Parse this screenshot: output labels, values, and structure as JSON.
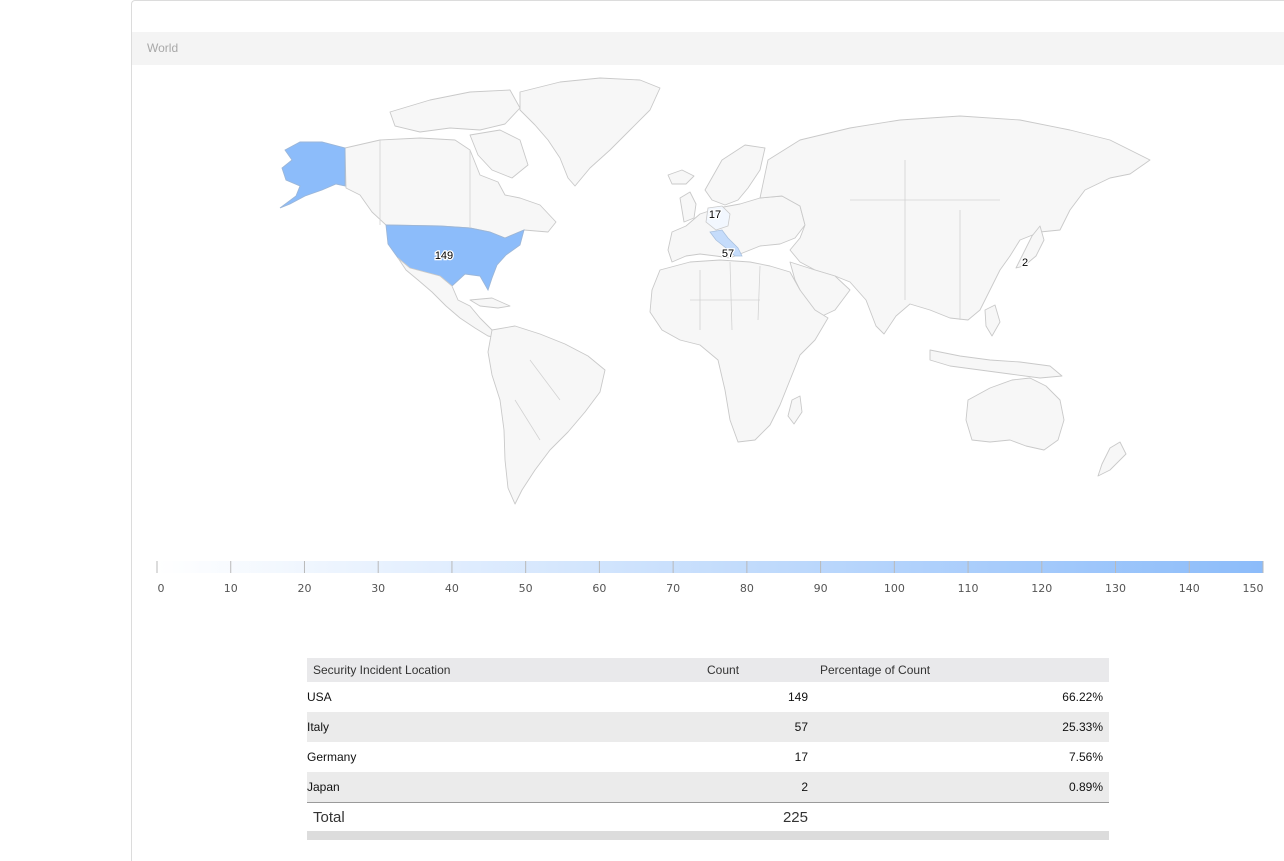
{
  "panel": {
    "title": "World"
  },
  "map": {
    "highlighted": [
      {
        "country": "USA",
        "label": "149"
      },
      {
        "country": "Germany",
        "label": "17"
      },
      {
        "country": "Italy",
        "label": "57"
      },
      {
        "country": "Japan",
        "label": "2"
      }
    ]
  },
  "legend": {
    "min": 0,
    "max": 150,
    "ticks": [
      "0",
      "10",
      "20",
      "30",
      "40",
      "50",
      "60",
      "70",
      "80",
      "90",
      "100",
      "110",
      "120",
      "130",
      "140",
      "150"
    ],
    "color_low": "#ffffff",
    "color_high": "#8cbcfa"
  },
  "table": {
    "headers": [
      "Security Incident Location",
      "Count",
      "Percentage of Count"
    ],
    "rows": [
      {
        "location": "USA",
        "count": "149",
        "pct": "66.22%"
      },
      {
        "location": "Italy",
        "count": "57",
        "pct": "25.33%"
      },
      {
        "location": "Germany",
        "count": "17",
        "pct": "7.56%"
      },
      {
        "location": "Japan",
        "count": "2",
        "pct": "0.89%"
      }
    ],
    "total_label": "Total",
    "total_count": "225"
  }
}
